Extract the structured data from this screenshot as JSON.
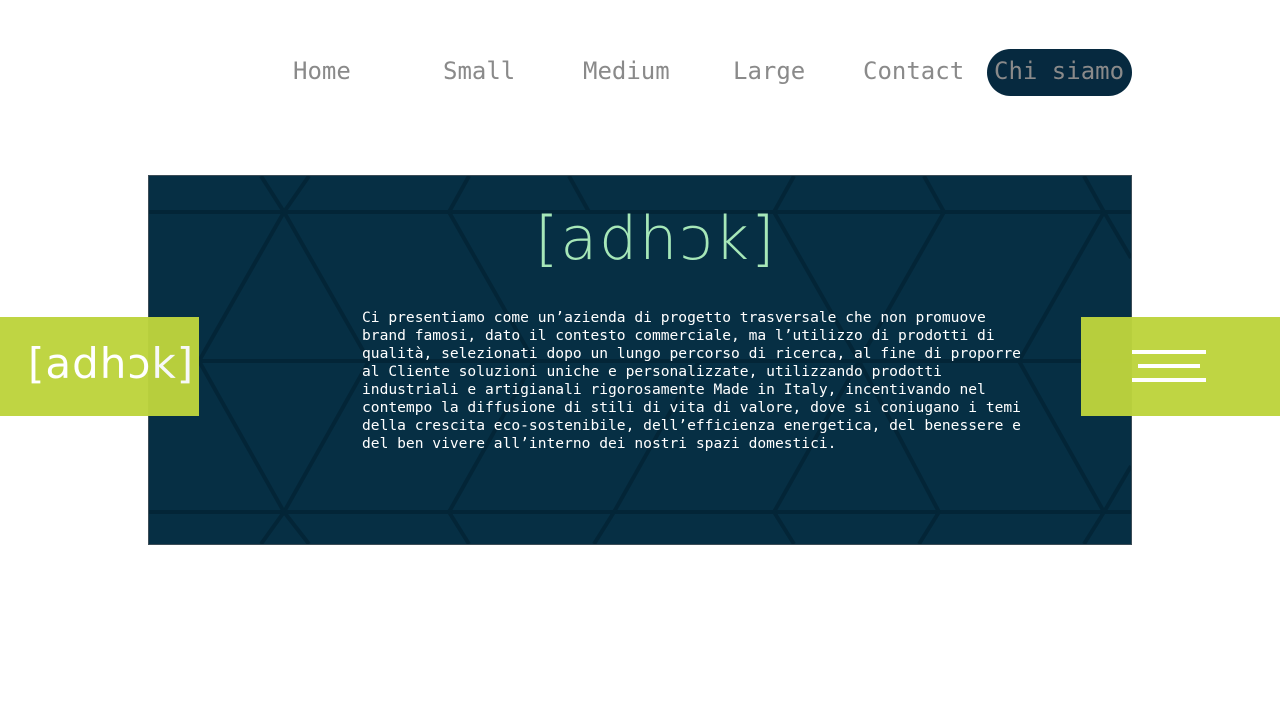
{
  "nav": {
    "items": [
      {
        "label": "Home"
      },
      {
        "label": "Small"
      },
      {
        "label": "Medium"
      },
      {
        "label": "Large"
      },
      {
        "label": "Contact"
      },
      {
        "label": "Chi siamo",
        "active": true
      }
    ]
  },
  "hero": {
    "logo_text": "[adhɔk]",
    "description": "Ci presentiamo come un’azienda di progetto trasversale che non promuove brand famosi, dato il contesto commerciale, ma l’utilizzo di prodotti di qualità, selezionati dopo un lungo percorso di ricerca, al fine di proporre al Cliente soluzioni uniche e personalizzate, utilizzando prodotti industriali e artigianali rigorosamente Made in Italy, incentivando nel contempo la diffusione di stili di vita di valore, dove si coniugano i temi della crescita eco-sostenibile, dell’efficienza energetica, del benessere e del ben vivere all’interno dei nostri spazi domestici."
  },
  "side_logo": {
    "text": "[adhɔk]"
  },
  "menu": {
    "icon": "hamburger-menu-icon"
  },
  "colors": {
    "navy": "#06293f",
    "lime": "#bdd43d",
    "mint": "#a6e7b8",
    "nav_text": "#8a8a8a"
  }
}
